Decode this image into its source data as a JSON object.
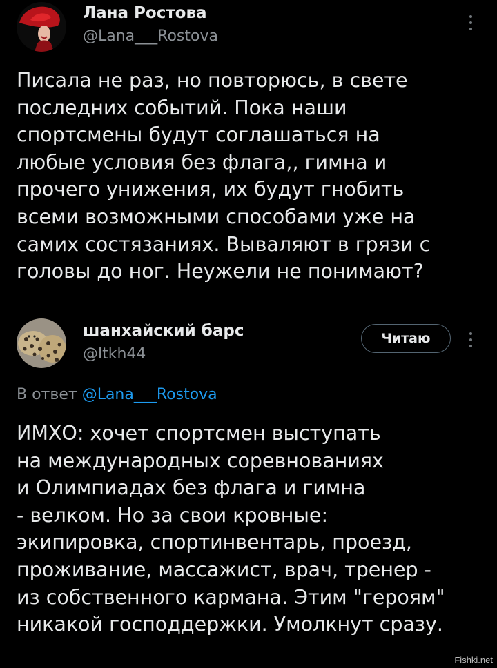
{
  "post": {
    "author_name": "Лана Ростова",
    "author_handle": "@Lana___Rostova",
    "text": "Писала  не раз, но повторюсь, в свете\nпоследних событий. Пока наши\nспортсмены будут соглашаться на\nлюбые условия  без флага,, гимна и\nпрочего унижения, их будут гнобить\nвсеми возможными способами уже на\nсамих состязаниях. Вываляют в грязи с\nголовы до ног. Неужели не понимают?"
  },
  "reply": {
    "author_name": "шанхайский барс",
    "author_handle": "@ltkh44",
    "follow_label": "Читаю",
    "reply_prefix": "В ответ",
    "reply_to_handle": "@Lana___Rostova",
    "text": "ИМХО: хочет спортсмен выступать\nна международных соревнованиях\nи Олимпиадах без флага и гимна\n- велком. Но за свои кровные:\nэкипировка, спортинвентарь, проезд,\nпроживание, массажист, врач, тренер -\nиз собственного кармана. Этим \"героям\"\nникакой господдержки. Умолкнут сразу."
  },
  "watermark": "Fishki.net",
  "colors": {
    "background": "#000000",
    "text": "#e7e9ea",
    "secondary": "#8b9095",
    "link": "#1d9bf0"
  }
}
